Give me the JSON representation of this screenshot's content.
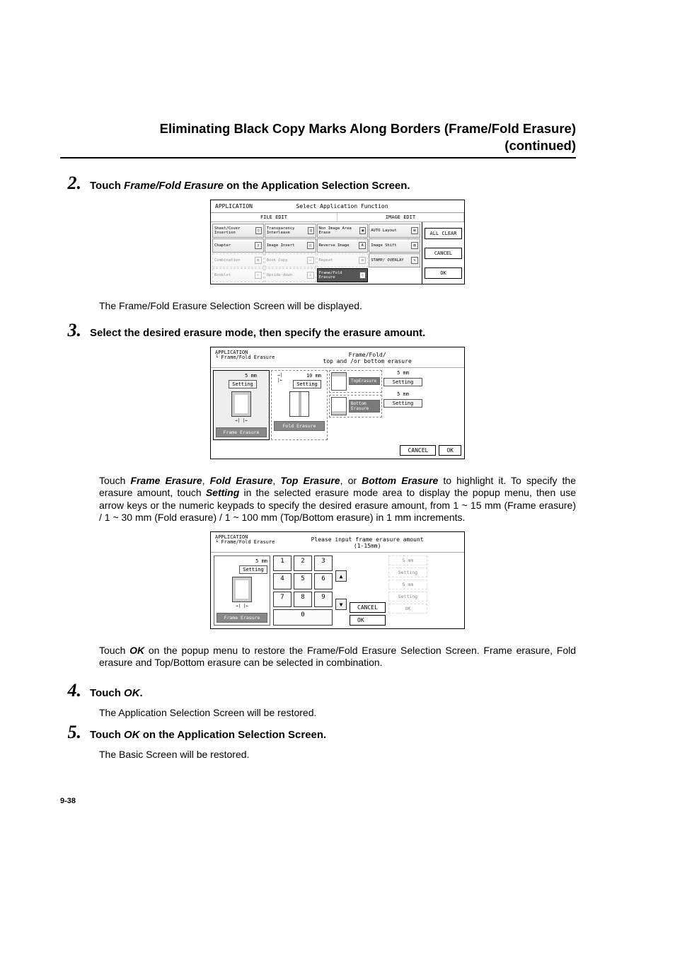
{
  "header": {
    "title_line1": "Eliminating Black Copy Marks Along Borders (Frame/Fold Erasure)",
    "title_line2": "(continued)"
  },
  "step2": {
    "num": "2.",
    "text_prefix": "Touch ",
    "text_italic": "Frame/Fold Erasure",
    "text_suffix": " on the Application Selection Screen.",
    "after_text": "The Frame/Fold Erasure Selection Screen will be displayed."
  },
  "screenshot1": {
    "breadcrumb": "APPLICATION",
    "title": "Select Application Function",
    "tab_file": "FILE EDIT",
    "tab_image": "IMAGE EDIT",
    "cells": {
      "sheet_cover": "Sheet/Cover Insertion",
      "transparency": "Transparency Interleave",
      "non_image": "Non Image Area Erase",
      "auto_layout": "AUTO Layout",
      "chapter": "Chapter",
      "image_insert": "Image Insert",
      "reverse": "Reverse Image",
      "image_shift": "Image Shift",
      "combination": "Combination",
      "book_copy": "Book Copy",
      "repeat": "Repeat",
      "stamp": "STAMP/ OVERLAY",
      "booklet": "Booklet",
      "upside": "Upside-down",
      "framefold": "Frame/Fold Erasure"
    },
    "side": {
      "all_clear": "ALL CLEAR",
      "cancel": "CANCEL",
      "ok": "OK"
    }
  },
  "step3": {
    "num": "3.",
    "text": "Select the desired erasure mode, then specify the erasure amount."
  },
  "screenshot2": {
    "breadcrumb1": "APPLICATION",
    "breadcrumb2": "Frame/Fold Erasure",
    "title_line1": "Frame/Fold/",
    "title_line2": "top and /or bottom erasure",
    "frame_val": "5 mm",
    "fold_val": "10 mm",
    "top_val": "5 mm",
    "bottom_val": "5 mm",
    "setting": "Setting",
    "frame_label": "Frame Erasure",
    "fold_label": "Fold Erasure",
    "top_label": "TopErasure",
    "bottom_label": "Bottom Erasure",
    "cancel": "CANCEL",
    "ok": "OK"
  },
  "para_after_ss2": {
    "t1": "Touch ",
    "i1": "Frame Erasure",
    "t2": ", ",
    "i2": "Fold Erasure",
    "t3": ", ",
    "i3": "Top Erasure",
    "t4": ", or ",
    "i4": "Bottom Erasure",
    "t5": " to highlight it. To specify the erasure amount, touch ",
    "i5": "Setting",
    "t6": " in the selected erasure mode area to display the popup menu, then use arrow keys or the numeric keypads to specify the desired erasure amount, from 1 ~ 15 mm (Frame erasure) / 1 ~ 30 mm (Fold erasure) / 1 ~ 100 mm (Top/Bottom erasure) in 1 mm increments."
  },
  "screenshot3": {
    "breadcrumb1": "APPLICATION",
    "breadcrumb2": "Frame/Fold Erasure",
    "title_line1": "Please input frame erasure amount",
    "title_line2": "(1-15mm)",
    "frame_val": "5 mm",
    "setting": "Setting",
    "frame_label": "Frame Erasure",
    "keys": {
      "k1": "1",
      "k2": "2",
      "k3": "3",
      "k4": "4",
      "k5": "5",
      "k6": "6",
      "k7": "7",
      "k8": "8",
      "k9": "9",
      "k0": "0"
    },
    "arrow_up": "▲",
    "arrow_down": "▼",
    "ghost_top_val": "5 mm",
    "ghost_top_set": "Setting",
    "ghost_bot_val": "5 mm",
    "ghost_bot_set": "Setting",
    "cancel": "CANCEL",
    "ok": "OK",
    "ghost_ok": "OK"
  },
  "para_after_ss3": "Touch OK on the popup menu to restore the Frame/Fold Erasure Selection Screen. Frame erasure, Fold erasure and Top/Bottom erasure can be selected in combination.",
  "para_after_ss3_prefix": "Touch ",
  "para_after_ss3_ok": "OK",
  "para_after_ss3_mid": " on the popup menu to restore the Frame/Fold Erasure Selection Screen. Frame erasure, Fold erasure and ",
  "para_after_ss3_tb": "Top/Bottom erasure",
  "para_after_ss3_end": " can be selected in combination.",
  "step4": {
    "num": "4.",
    "text_prefix": "Touch ",
    "text_italic": "OK",
    "text_suffix": ".",
    "after_text": "The Application Selection Screen will be restored."
  },
  "step5": {
    "num": "5.",
    "text_prefix": "Touch ",
    "text_italic": "OK",
    "text_suffix": " on the Application Selection Screen.",
    "after_text": "The Basic Screen will be restored."
  },
  "footer": "9-38"
}
